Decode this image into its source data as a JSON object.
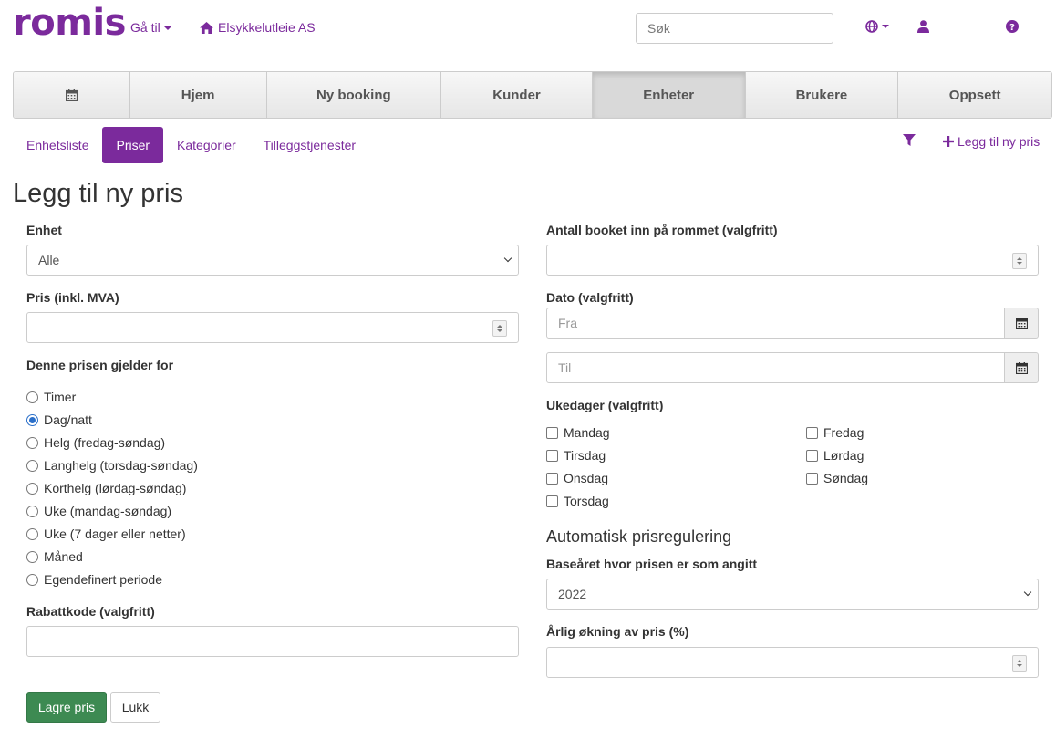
{
  "header": {
    "logo": "romis",
    "goto_label": "Gå til",
    "company": "Elsykkelutleie AS",
    "search_placeholder": "Søk"
  },
  "mainnav": {
    "tabs": [
      {
        "label": ""
      },
      {
        "label": "Hjem"
      },
      {
        "label": "Ny booking"
      },
      {
        "label": "Kunder"
      },
      {
        "label": "Enheter"
      },
      {
        "label": "Brukere"
      },
      {
        "label": "Oppsett"
      }
    ],
    "active": "Enheter"
  },
  "subnav": {
    "tabs": [
      {
        "label": "Enhetsliste"
      },
      {
        "label": "Priser"
      },
      {
        "label": "Kategorier"
      },
      {
        "label": "Tilleggstjenester"
      }
    ],
    "active": "Priser",
    "add_label": "Legg til ny pris"
  },
  "form": {
    "title": "Legg til ny pris",
    "unit_label": "Enhet",
    "unit_value": "Alle",
    "price_label": "Pris (inkl. MVA)",
    "applies_label": "Denne prisen gjelder for",
    "periods": [
      {
        "label": "Timer",
        "selected": false
      },
      {
        "label": "Dag/natt",
        "selected": true
      },
      {
        "label": "Helg (fredag-søndag)",
        "selected": false
      },
      {
        "label": "Langhelg (torsdag-søndag)",
        "selected": false
      },
      {
        "label": "Korthelg (lørdag-søndag)",
        "selected": false
      },
      {
        "label": "Uke (mandag-søndag)",
        "selected": false
      },
      {
        "label": "Uke (7 dager eller netter)",
        "selected": false
      },
      {
        "label": "Måned",
        "selected": false
      },
      {
        "label": "Egendefinert periode",
        "selected": false
      }
    ],
    "discount_label": "Rabattkode (valgfritt)",
    "booked_label": "Antall booket inn på rommet (valgfritt)",
    "date_label": "Dato (valgfritt)",
    "date_from_placeholder": "Fra",
    "date_to_placeholder": "Til",
    "weekdays_label": "Ukedager (valgfritt)",
    "weekdays": [
      {
        "label": "Mandag"
      },
      {
        "label": "Tirsdag"
      },
      {
        "label": "Onsdag"
      },
      {
        "label": "Torsdag"
      },
      {
        "label": "Fredag"
      },
      {
        "label": "Lørdag"
      },
      {
        "label": "Søndag"
      }
    ],
    "auto_heading": "Automatisk prisregulering",
    "base_year_label": "Baseåret hvor prisen er som angitt",
    "base_year_value": "2022",
    "increase_label": "Årlig økning av pris (%)",
    "save_button": "Lagre pris",
    "close_button": "Lukk"
  },
  "colors": {
    "brand": "#7b2a9c",
    "save": "#3d8a52",
    "radio_selected": "#2a6fc9"
  }
}
